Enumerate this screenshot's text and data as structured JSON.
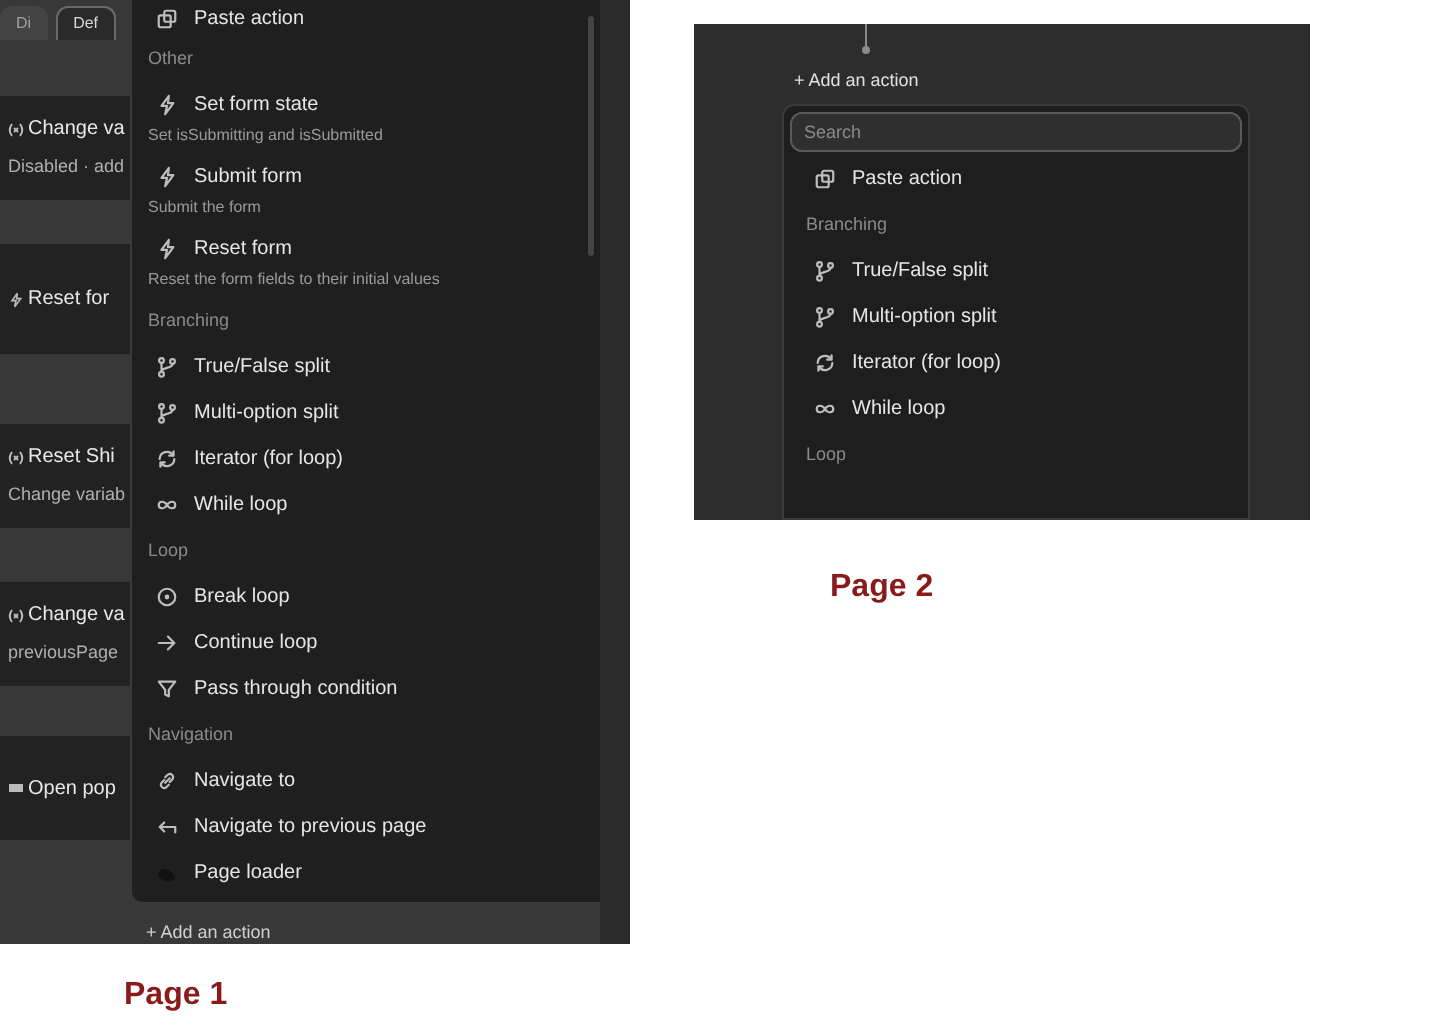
{
  "page1": {
    "caption": "Page 1",
    "tabs": [
      {
        "label": "Di",
        "selected": false
      },
      {
        "label": "Def",
        "selected": true
      }
    ],
    "cards": [
      {
        "kind": "variable",
        "title": "Change va",
        "subtitle": "Disabled · add"
      },
      {
        "kind": "form",
        "title": "Reset for"
      },
      {
        "kind": "variable",
        "title": "Reset Shi",
        "subtitle": "Change variab"
      },
      {
        "kind": "variable",
        "title": "Change va",
        "subtitle": "previousPage"
      },
      {
        "kind": "popup",
        "title": "Open pop"
      }
    ],
    "menu": [
      {
        "kind": "action",
        "label": "Paste action"
      },
      {
        "kind": "section",
        "label": "Other"
      },
      {
        "kind": "action",
        "label": "Set form state",
        "description": "Set isSubmitting and isSubmitted"
      },
      {
        "kind": "action",
        "label": "Submit form",
        "description": "Submit the form"
      },
      {
        "kind": "action",
        "label": "Reset form",
        "description": "Reset the form fields to their initial values"
      },
      {
        "kind": "section",
        "label": "Branching"
      },
      {
        "kind": "action",
        "label": "True/False split"
      },
      {
        "kind": "action",
        "label": "Multi-option split"
      },
      {
        "kind": "action",
        "label": "Iterator (for loop)"
      },
      {
        "kind": "action",
        "label": "While loop"
      },
      {
        "kind": "section",
        "label": "Loop"
      },
      {
        "kind": "action",
        "label": "Break loop"
      },
      {
        "kind": "action",
        "label": "Continue loop"
      },
      {
        "kind": "action",
        "label": "Pass through condition"
      },
      {
        "kind": "section",
        "label": "Navigation"
      },
      {
        "kind": "action",
        "label": "Navigate to"
      },
      {
        "kind": "action",
        "label": "Navigate to previous page"
      },
      {
        "kind": "action",
        "label": "Page loader"
      }
    ],
    "add_action": "+ Add an action"
  },
  "page2": {
    "caption": "Page 2",
    "add_action": "+ Add an action",
    "search": {
      "placeholder": "Search"
    },
    "menu": [
      {
        "kind": "action",
        "label": "Paste action"
      },
      {
        "kind": "section",
        "label": "Branching"
      },
      {
        "kind": "action",
        "label": "True/False split"
      },
      {
        "kind": "action",
        "label": "Multi-option split"
      },
      {
        "kind": "action",
        "label": "Iterator (for loop)"
      },
      {
        "kind": "action",
        "label": "While loop"
      },
      {
        "kind": "section",
        "label": "Loop"
      }
    ]
  }
}
